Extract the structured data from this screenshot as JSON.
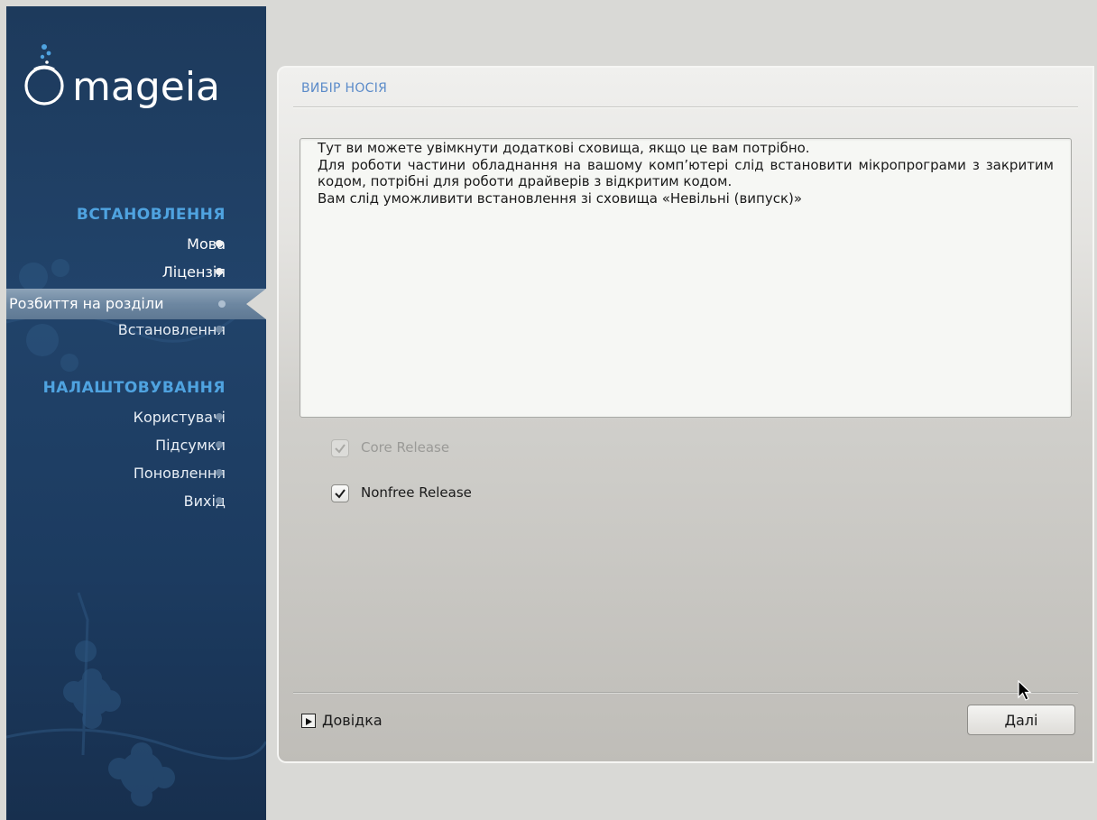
{
  "app": {
    "brand": "mageia"
  },
  "sidebar": {
    "sections": [
      {
        "title": "ВСТАНОВЛЕННЯ",
        "items": [
          {
            "label": "Мова",
            "state": "done"
          },
          {
            "label": "Ліцензія",
            "state": "done"
          },
          {
            "label": "Розбиття на розділи",
            "state": "current"
          },
          {
            "label": "Встановлення",
            "state": "pending"
          }
        ]
      },
      {
        "title": "НАЛАШТОВУВАННЯ",
        "items": [
          {
            "label": "Користувачі",
            "state": "pending"
          },
          {
            "label": "Підсумки",
            "state": "pending"
          },
          {
            "label": "Поновлення",
            "state": "pending"
          },
          {
            "label": "Вихід",
            "state": "pending"
          }
        ]
      }
    ]
  },
  "main": {
    "title": "ВИБІР НОСІЯ",
    "info_lines": [
      "Тут ви можете увімкнути додаткові сховища, якщо це вам потрібно.",
      "Для роботи частини обладнання на вашому комп’ютері слід встановити мікропрограми з закритим кодом, потрібні для роботи драйверів з відкритим кодом.",
      "Вам слід уможливити встановлення зі сховища «Невільні (випуск)»"
    ],
    "checkboxes": [
      {
        "label": "Core Release",
        "checked": true,
        "enabled": false
      },
      {
        "label": "Nonfree Release",
        "checked": true,
        "enabled": true
      }
    ],
    "help_label": "Довідка",
    "next_label": "Далі"
  },
  "colors": {
    "sidebar_bg": "#1d3a5c",
    "section_title": "#4fa3e0",
    "page_title": "#5b8bc9"
  }
}
